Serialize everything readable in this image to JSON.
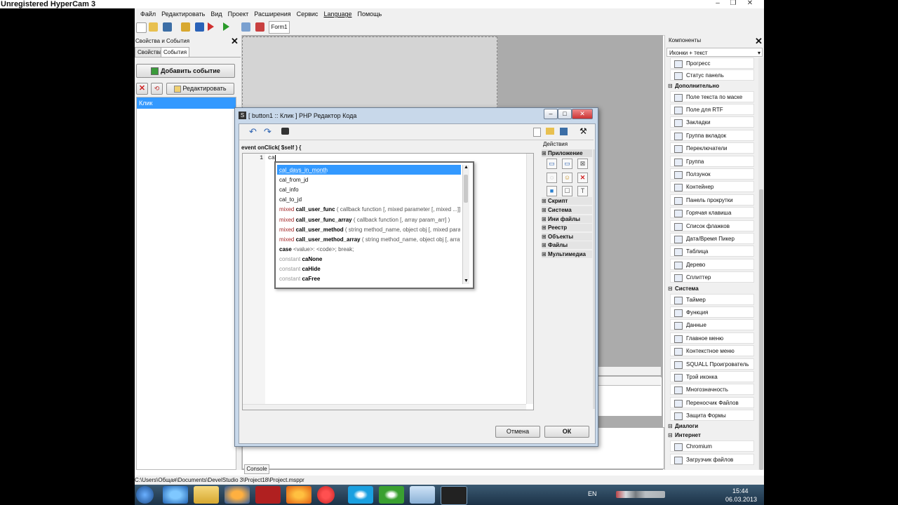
{
  "overlay_title": "Unregistered HyperCam 3",
  "menu": [
    "Файл",
    "Редактировать",
    "Вид",
    "Проект",
    "Расширения",
    "Сервис",
    "Language",
    "Помощь"
  ],
  "toolbar": {
    "form_tab": "Form1"
  },
  "left_panel": {
    "title": "Свойства и События",
    "tabs": [
      "Свойства",
      "События"
    ],
    "add_event": "Добавить событие",
    "edit": "Редактировать",
    "events": [
      "Клик"
    ]
  },
  "right_panel": {
    "title": "Компоненты",
    "dropdown": "Иконки + текст",
    "items_top": [
      "Прогресс",
      "Статус панель"
    ],
    "cat_additional": "Дополнительно",
    "items_additional": [
      "Поле текста по маске",
      "Поле для RTF",
      "Закладки",
      "Группа вкладок",
      "Переключатели",
      "Группа",
      "Ползунок",
      "Контейнер",
      "Панель прокрутки",
      "Горячая клавиша",
      "Список флажков",
      "Дата/Время Пикер",
      "Таблица",
      "Дерево",
      "Сплиттер"
    ],
    "cat_system": "Система",
    "items_system": [
      "Таймер",
      "Функция",
      "Данные",
      "Главное меню",
      "Контекстное меню",
      "SQUALL Проигрователь",
      "Трэй иконка",
      "Многозначность",
      "Переносчик Файлов",
      "Защита Формы"
    ],
    "cat_dialogs": "Диалоги",
    "cat_internet": "Интернет",
    "items_internet": [
      "Chromium",
      "Загрузчик файлов"
    ]
  },
  "dialog": {
    "title": "[ button1 :: Клик ] PHP Редактор Кода",
    "header": "event onClick( $self ) {",
    "line_number": "1",
    "line_text": "ca",
    "actions_title": "Действия",
    "groups": [
      "Приложение",
      "Скрипт",
      "Система",
      "Ини файлы",
      "Реестр",
      "Объекты",
      "Файлы",
      "Мультимедиа"
    ],
    "cancel": "Отмена",
    "ok": "ОК"
  },
  "autocomplete": [
    {
      "prefix": "",
      "name": "cal_days_in_month",
      "args": ""
    },
    {
      "prefix": "",
      "name": "cal_from_jd",
      "args": ""
    },
    {
      "prefix": "",
      "name": "cal_info",
      "args": ""
    },
    {
      "prefix": "",
      "name": "cal_to_jd",
      "args": ""
    },
    {
      "prefix": "mixed",
      "name": "call_user_func",
      "args": "( callback function [, mixed parameter [, mixed ...]] )"
    },
    {
      "prefix": "mixed",
      "name": "call_user_func_array",
      "args": "( callback function [, array param_arr] )"
    },
    {
      "prefix": "mixed",
      "name": "call_user_method",
      "args": "( string method_name, object obj [, mixed paramet"
    },
    {
      "prefix": "mixed",
      "name": "call_user_method_array",
      "args": "( string method_name, object obj [, array pa"
    },
    {
      "prefix": "",
      "name": "case",
      "args": "<value>: <code>; break;"
    },
    {
      "prefix": "constant",
      "name": "caNone",
      "args": ""
    },
    {
      "prefix": "constant",
      "name": "caHide",
      "args": ""
    },
    {
      "prefix": "constant",
      "name": "caFree",
      "args": ""
    }
  ],
  "console_tab": "Console",
  "status_path": "C:\\Users\\Общая\\Documents\\DevelStudio 3\\Project18\\Project.msppr",
  "tray": {
    "lang": "EN",
    "time": "15:44",
    "date": "06.03.2013"
  }
}
